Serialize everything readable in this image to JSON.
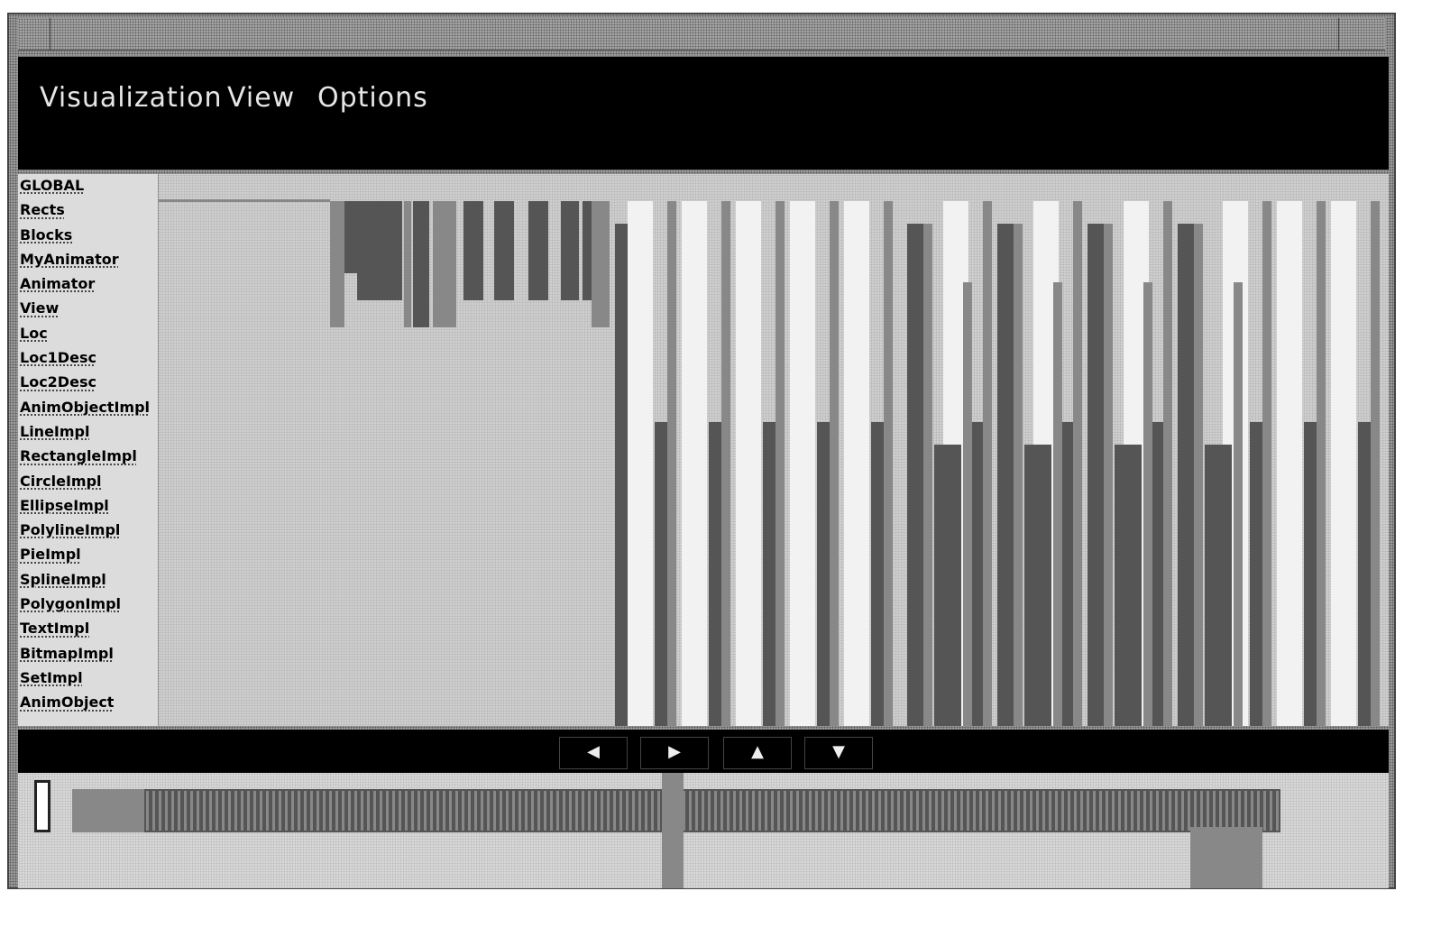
{
  "window": {
    "title": ""
  },
  "menu": {
    "items": [
      "Visualization",
      "View",
      "Options"
    ]
  },
  "class_list": {
    "items": [
      "GLOBAL",
      "Rects",
      "Blocks",
      "MyAnimator",
      "Animator",
      "View",
      "Loc",
      "Loc1Desc",
      "Loc2Desc",
      "AnimObjectImpl",
      "LineImpl",
      "RectangleImpl",
      "CircleImpl",
      "EllipseImpl",
      "PolylineImpl",
      "PieImpl",
      "SplineImpl",
      "PolygonImpl",
      "TextImpl",
      "BitmapImpl",
      "SetImpl",
      "AnimObject"
    ]
  },
  "nav": {
    "buttons": [
      {
        "name": "scroll-left-button",
        "glyph": "◀",
        "icon": "arrow-left-icon"
      },
      {
        "name": "scroll-right-button",
        "glyph": "▶",
        "icon": "arrow-right-icon"
      },
      {
        "name": "scroll-up-button",
        "glyph": "▲",
        "icon": "arrow-up-icon"
      },
      {
        "name": "scroll-down-button",
        "glyph": "▼",
        "icon": "arrow-down-icon"
      }
    ]
  },
  "colors": {
    "menubar": "#000000",
    "menu_text": "#e6e6e6",
    "bar_dark": "#555555",
    "bar_mid": "#888888",
    "bar_light": "#f2f2f2",
    "timeline_bg": "#cfcfcf"
  }
}
